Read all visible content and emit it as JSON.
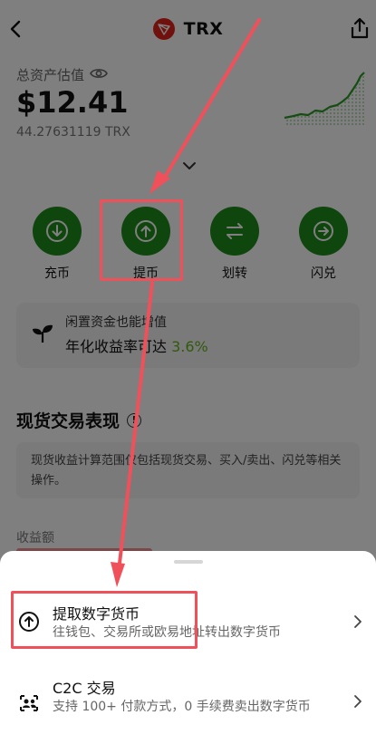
{
  "header": {
    "back_icon": "chevron-left-icon",
    "title": "TRX",
    "logo_icon": "tron-logo-icon",
    "share_icon": "share-icon"
  },
  "balance": {
    "label": "总资产估值",
    "visibility_icon": "eye-icon",
    "value": "$12.41",
    "amount": "44.27631119 TRX",
    "expand_icon": "chevron-down-icon"
  },
  "actions": [
    {
      "label": "充币",
      "icon": "deposit-icon"
    },
    {
      "label": "提币",
      "icon": "withdraw-icon"
    },
    {
      "label": "划转",
      "icon": "transfer-icon"
    },
    {
      "label": "闪兑",
      "icon": "convert-icon"
    }
  ],
  "promo": {
    "line1": "闲置资金也能增值",
    "line2": "年化收益率可达",
    "rate": "3.6%",
    "icon": "plant-icon"
  },
  "spot": {
    "title": "现货交易表现",
    "info_icon": "info-icon",
    "note": "现货收益计算范围仅包括现货交易、买入/卖出、闪兑等相关操作。",
    "income_label": "收益额"
  },
  "sheet": {
    "options": [
      {
        "title": "提取数字货币",
        "desc": "往钱包、交易所或欧易地址转出数字货币",
        "icon": "withdraw-icon"
      },
      {
        "title": "C2C 交易",
        "desc": "支持 100+ 付款方式，0 手续费卖出数字货币",
        "icon": "c2c-users-icon"
      }
    ]
  },
  "colors": {
    "brand_green": "#1f8c1a",
    "trx_red": "#e2231a",
    "accent_green": "#61b51a",
    "annotation_red": "#f0505a"
  }
}
